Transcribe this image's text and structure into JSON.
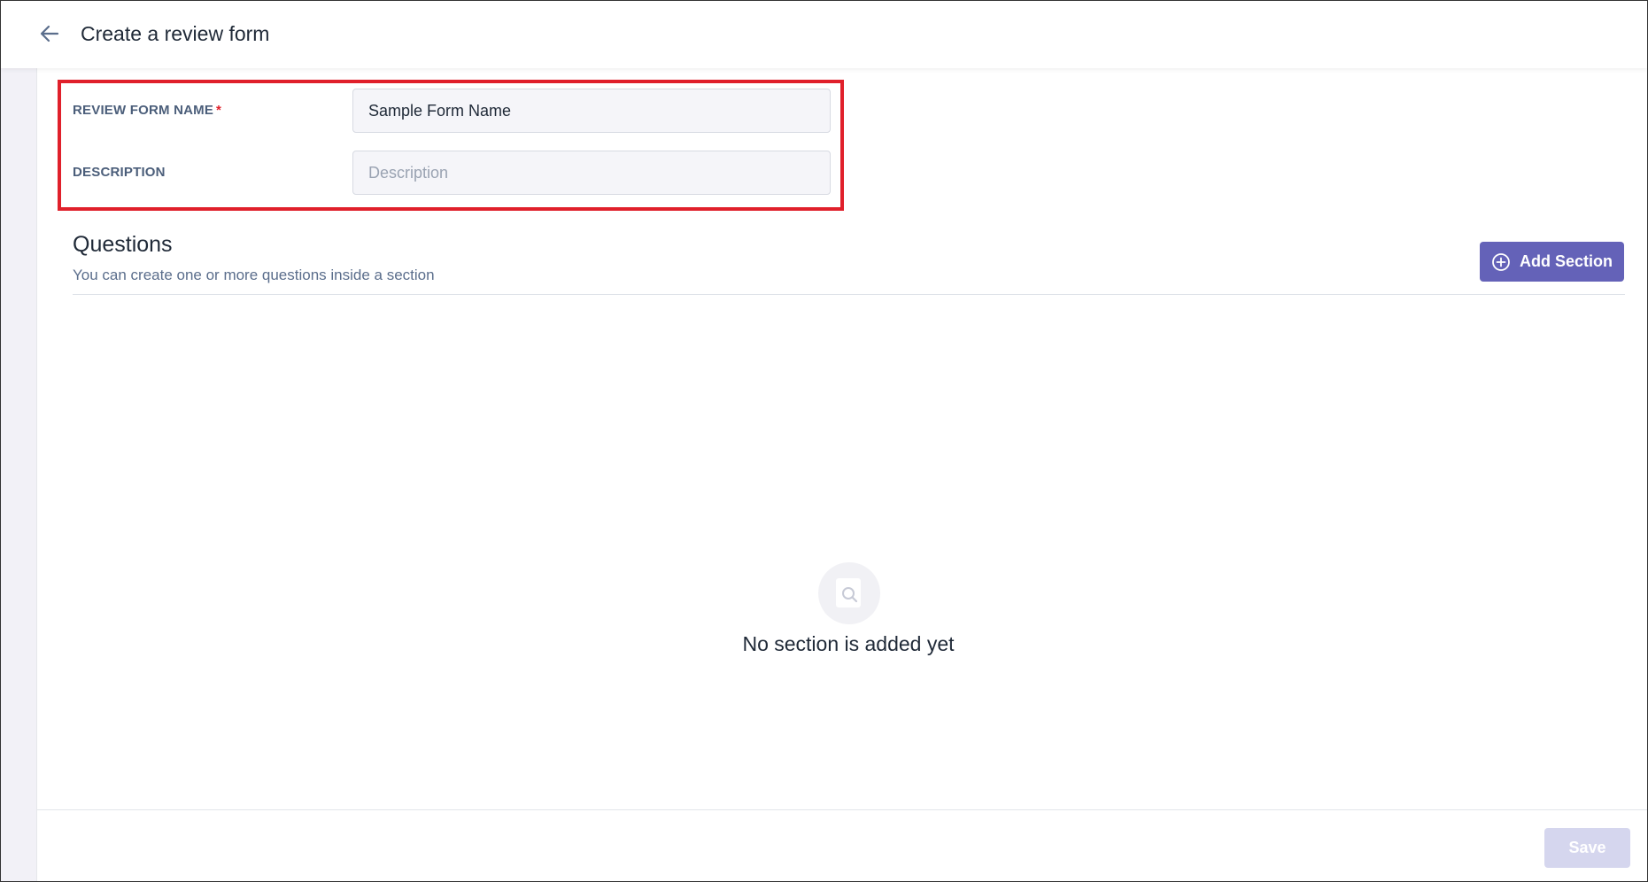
{
  "header": {
    "title": "Create a review form",
    "back_icon": "arrow-left-icon"
  },
  "form": {
    "name_label": "REVIEW FORM NAME",
    "required_mark": "*",
    "name_value": "Sample Form Name",
    "description_label": "DESCRIPTION",
    "description_value": "",
    "description_placeholder": "Description"
  },
  "questions": {
    "title": "Questions",
    "subtitle": "You can create one or more questions inside a section",
    "add_section_label": "Add Section",
    "add_section_icon": "plus-circle-icon"
  },
  "empty_state": {
    "icon": "search-document-icon",
    "message": "No section is added yet"
  },
  "footer": {
    "save_label": "Save"
  },
  "colors": {
    "accent": "#6462b8",
    "highlight": "#e0202b",
    "disabled_button": "#d5d6ee"
  }
}
